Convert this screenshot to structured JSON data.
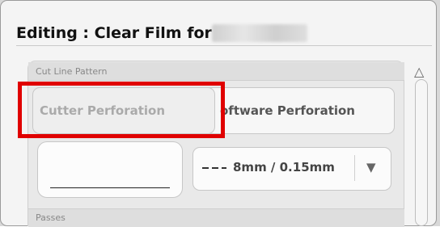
{
  "dialog": {
    "title": "Editing : Clear Film for"
  },
  "cut_line_pattern": {
    "label": "Cut Line Pattern",
    "options": [
      {
        "label": "Cutter Perforation",
        "selected": true
      },
      {
        "label": "oftware Perforation",
        "selected": false
      }
    ]
  },
  "line_style": {
    "selected_value": "8mm / 0.15mm",
    "arrow": "▼"
  },
  "passes": {
    "label": "Passes"
  },
  "scrollbar": {
    "up_arrow": "△"
  },
  "colors": {
    "highlight": "#e00000"
  }
}
